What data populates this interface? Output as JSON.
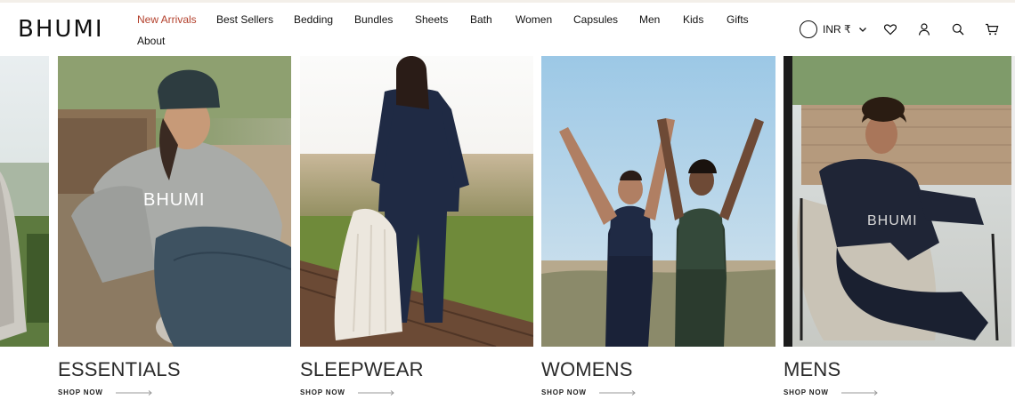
{
  "brand": {
    "logo_text": "BHUMI"
  },
  "nav": {
    "items": [
      {
        "label": "New Arrivals",
        "active": true
      },
      {
        "label": "Best Sellers",
        "active": false
      },
      {
        "label": "Bedding",
        "active": false
      },
      {
        "label": "Bundles",
        "active": false
      },
      {
        "label": "Sheets",
        "active": false
      },
      {
        "label": "Bath",
        "active": false
      },
      {
        "label": "Women",
        "active": false
      },
      {
        "label": "Capsules",
        "active": false
      },
      {
        "label": "Men",
        "active": false
      },
      {
        "label": "Kids",
        "active": false
      },
      {
        "label": "Gifts",
        "active": false
      },
      {
        "label": "About",
        "active": false
      }
    ],
    "active_color": "#b3402c"
  },
  "header": {
    "currency_label": "INR ₹",
    "icons": [
      "heart-icon",
      "user-icon",
      "search-icon",
      "cart-icon"
    ]
  },
  "categories": [
    {
      "title": "ESSENTIALS",
      "cta": "SHOP NOW",
      "hoodie_text": "BHUMI"
    },
    {
      "title": "SLEEPWEAR",
      "cta": "SHOP NOW"
    },
    {
      "title": "WOMENS",
      "cta": "SHOP NOW"
    },
    {
      "title": "MENS",
      "cta": "SHOP NOW",
      "hoodie_text": "BHUMI"
    }
  ]
}
